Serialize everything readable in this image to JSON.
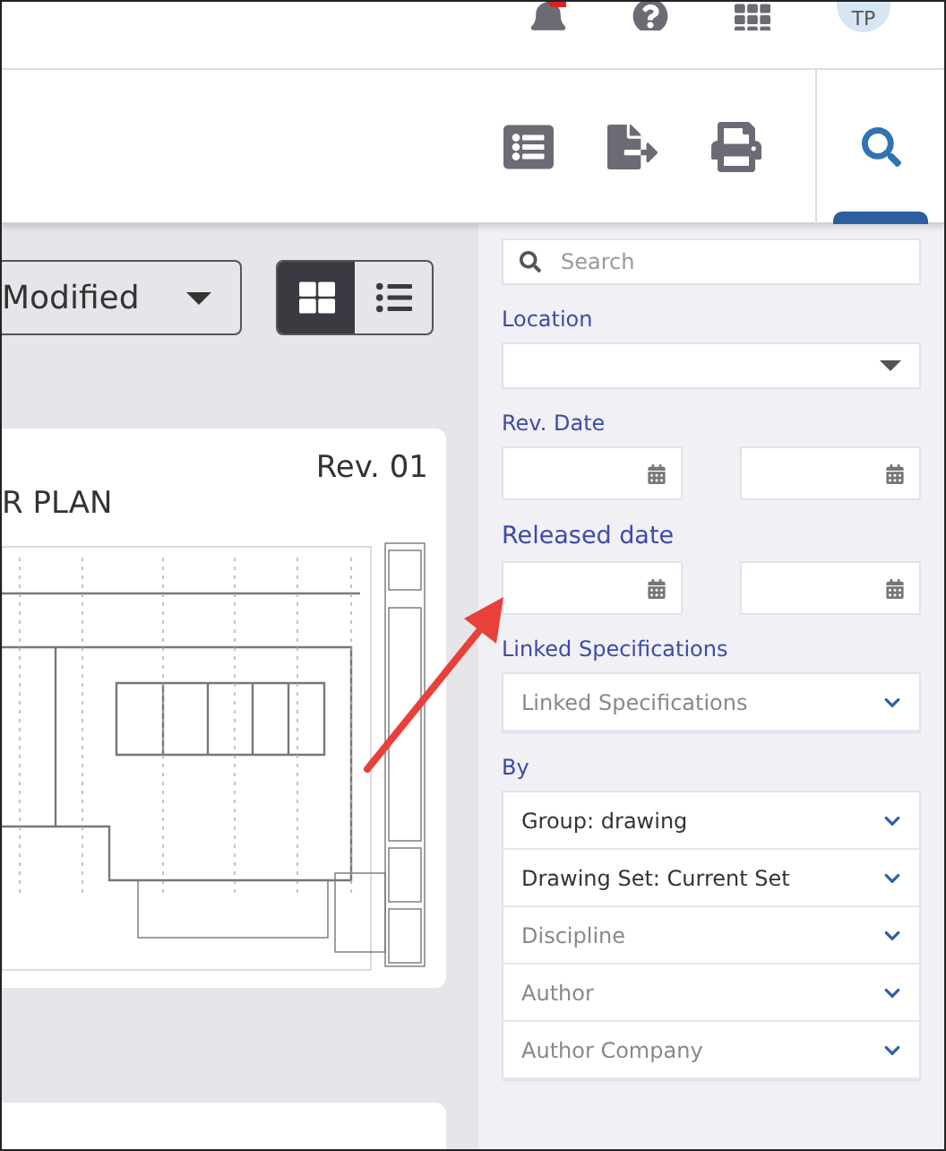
{
  "header": {
    "avatar_initials": "TP",
    "notification_badge": true
  },
  "toolbar": {
    "tabs": [
      {
        "kind": "search",
        "selected": true
      }
    ]
  },
  "sort": {
    "value": "Modified"
  },
  "view_toggle": [
    {
      "kind": "grid",
      "selected": true
    },
    {
      "kind": "list",
      "selected": false
    }
  ],
  "cards": [
    {
      "revision": "Rev. 01",
      "title": "R PLAN"
    }
  ],
  "filters": {
    "search": {
      "placeholder": "Search"
    },
    "location": {
      "label": "Location"
    },
    "rev_date": {
      "label": "Rev. Date"
    },
    "released_date": {
      "label": "Released date"
    },
    "linked_specifications": {
      "label": "Linked Specifications",
      "placeholder": "Linked Specifications"
    },
    "by": {
      "label": "By",
      "items": [
        {
          "label": "Group: drawing",
          "active": true
        },
        {
          "label": "Drawing Set: Current Set",
          "active": true
        },
        {
          "label": "Discipline",
          "active": false
        },
        {
          "label": "Author",
          "active": false
        },
        {
          "label": "Author Company",
          "active": false
        }
      ]
    }
  }
}
